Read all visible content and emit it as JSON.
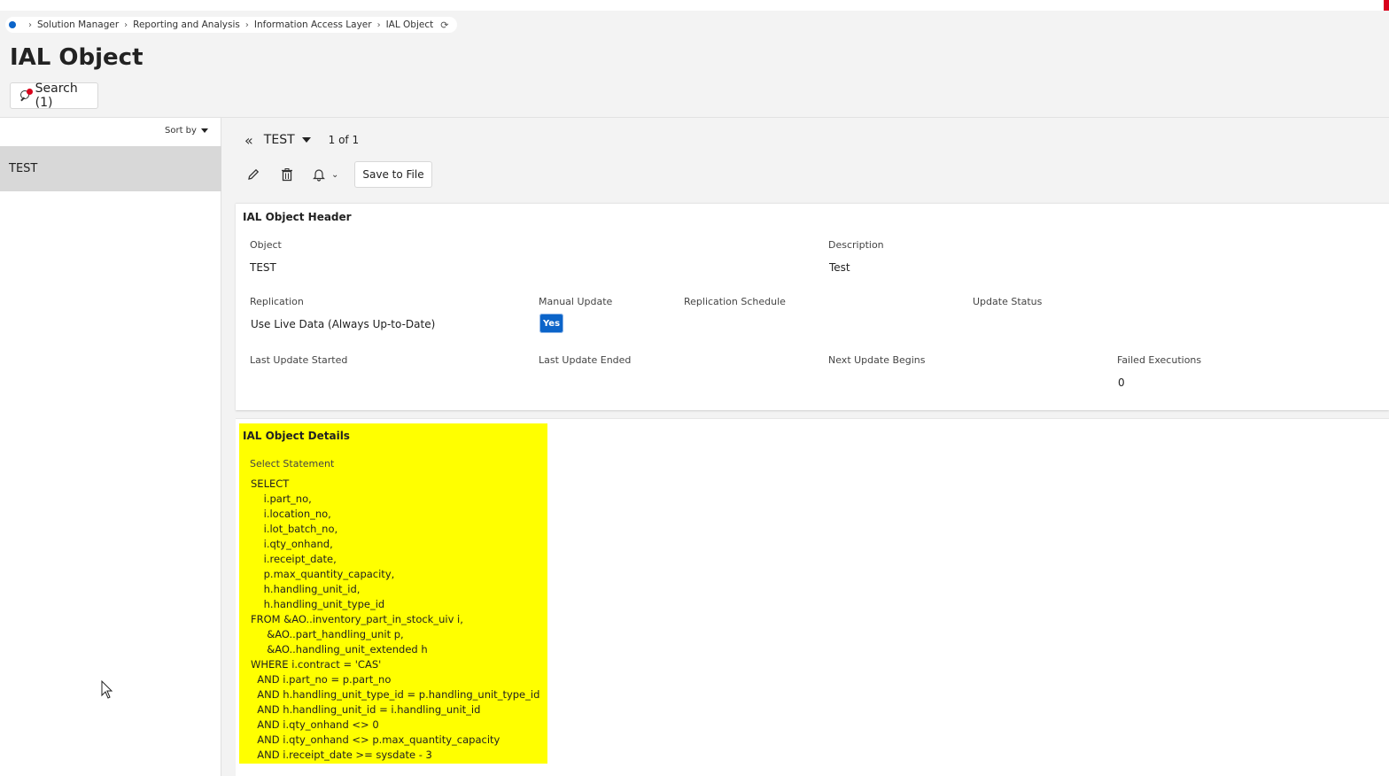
{
  "breadcrumb": {
    "items": [
      "Solution Manager",
      "Reporting and Analysis",
      "Information Access Layer",
      "IAL Object"
    ]
  },
  "page": {
    "title": "IAL Object"
  },
  "search": {
    "label": "Search (1)"
  },
  "list": {
    "sort_label": "Sort by",
    "items": [
      "TEST"
    ]
  },
  "record_nav": {
    "name": "TEST",
    "count": "1 of 1"
  },
  "toolbar": {
    "save_label": "Save to File"
  },
  "header_card": {
    "title": "IAL Object Header",
    "object_label": "Object",
    "object_value": "TEST",
    "description_label": "Description",
    "description_value": "Test",
    "replication_label": "Replication",
    "replication_value": "Use Live Data (Always Up-to-Date)",
    "manual_update_label": "Manual Update",
    "manual_update_value": "Yes",
    "replication_schedule_label": "Replication Schedule",
    "update_status_label": "Update Status",
    "last_update_started_label": "Last Update Started",
    "last_update_ended_label": "Last Update Ended",
    "next_update_begins_label": "Next Update Begins",
    "failed_executions_label": "Failed Executions",
    "failed_executions_value": "0"
  },
  "details_card": {
    "title": "IAL Object Details",
    "select_label": "Select Statement",
    "sql": "SELECT\n    i.part_no,\n    i.location_no,\n    i.lot_batch_no,\n    i.qty_onhand,\n    i.receipt_date,\n    p.max_quantity_capacity,\n    h.handling_unit_id,\n    h.handling_unit_type_id\nFROM &AO..inventory_part_in_stock_uiv i,\n     &AO..part_handling_unit p,\n     &AO..handling_unit_extended h\nWHERE i.contract = 'CAS'\n  AND i.part_no = p.part_no\n  AND h.handling_unit_type_id = p.handling_unit_type_id\n  AND h.handling_unit_id = i.handling_unit_id\n  AND i.qty_onhand <> 0\n  AND i.qty_onhand <> p.max_quantity_capacity\n  AND i.receipt_date >= sysdate - 3"
  },
  "colors": {
    "accent": "#0b64c9",
    "highlight": "#ffff00",
    "selected_row": "#d8d8d8",
    "notification": "#d9001b"
  }
}
